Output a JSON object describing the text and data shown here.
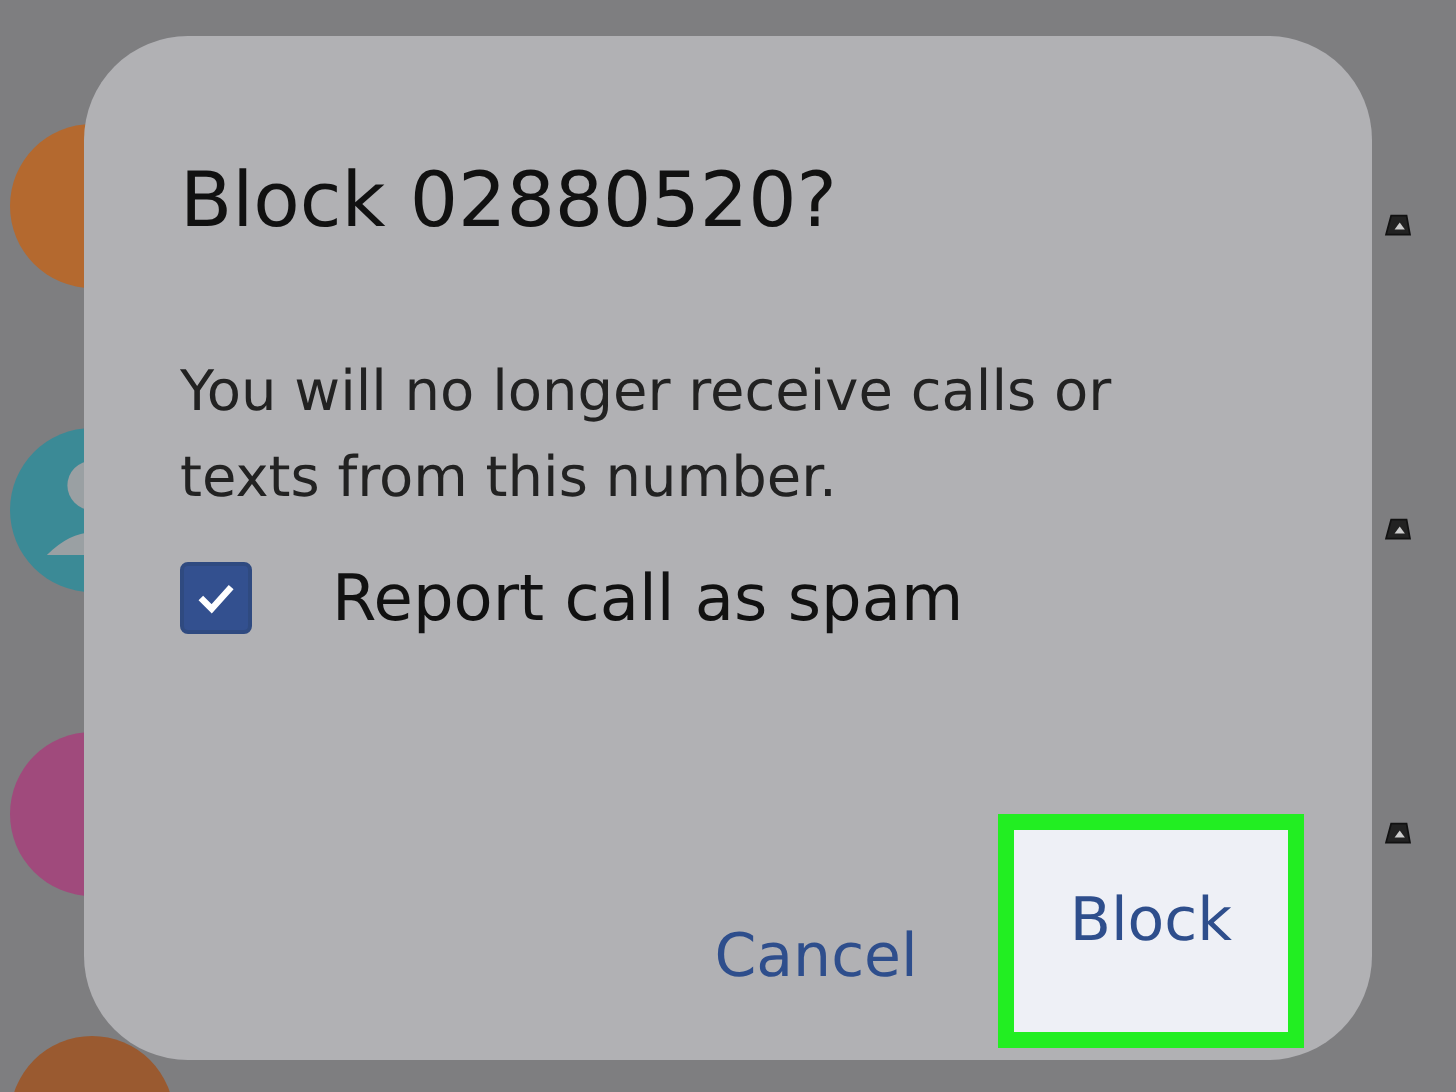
{
  "contacts": [
    {
      "color": "#b4692f",
      "kind": "letter"
    },
    {
      "color": "#3b8a96",
      "kind": "person"
    },
    {
      "color": "#a04a7c",
      "kind": "letter"
    },
    {
      "color": "#9a5a30",
      "kind": "letter"
    }
  ],
  "dialog": {
    "title": "Block 02880520?",
    "message": "You will no longer receive calls or texts from this number.",
    "checkbox": {
      "label": "Report call as spam",
      "checked": true
    },
    "buttons": [
      {
        "label": "Cancel",
        "highlighted": false
      },
      {
        "label": "Block",
        "highlighted": true
      }
    ]
  }
}
